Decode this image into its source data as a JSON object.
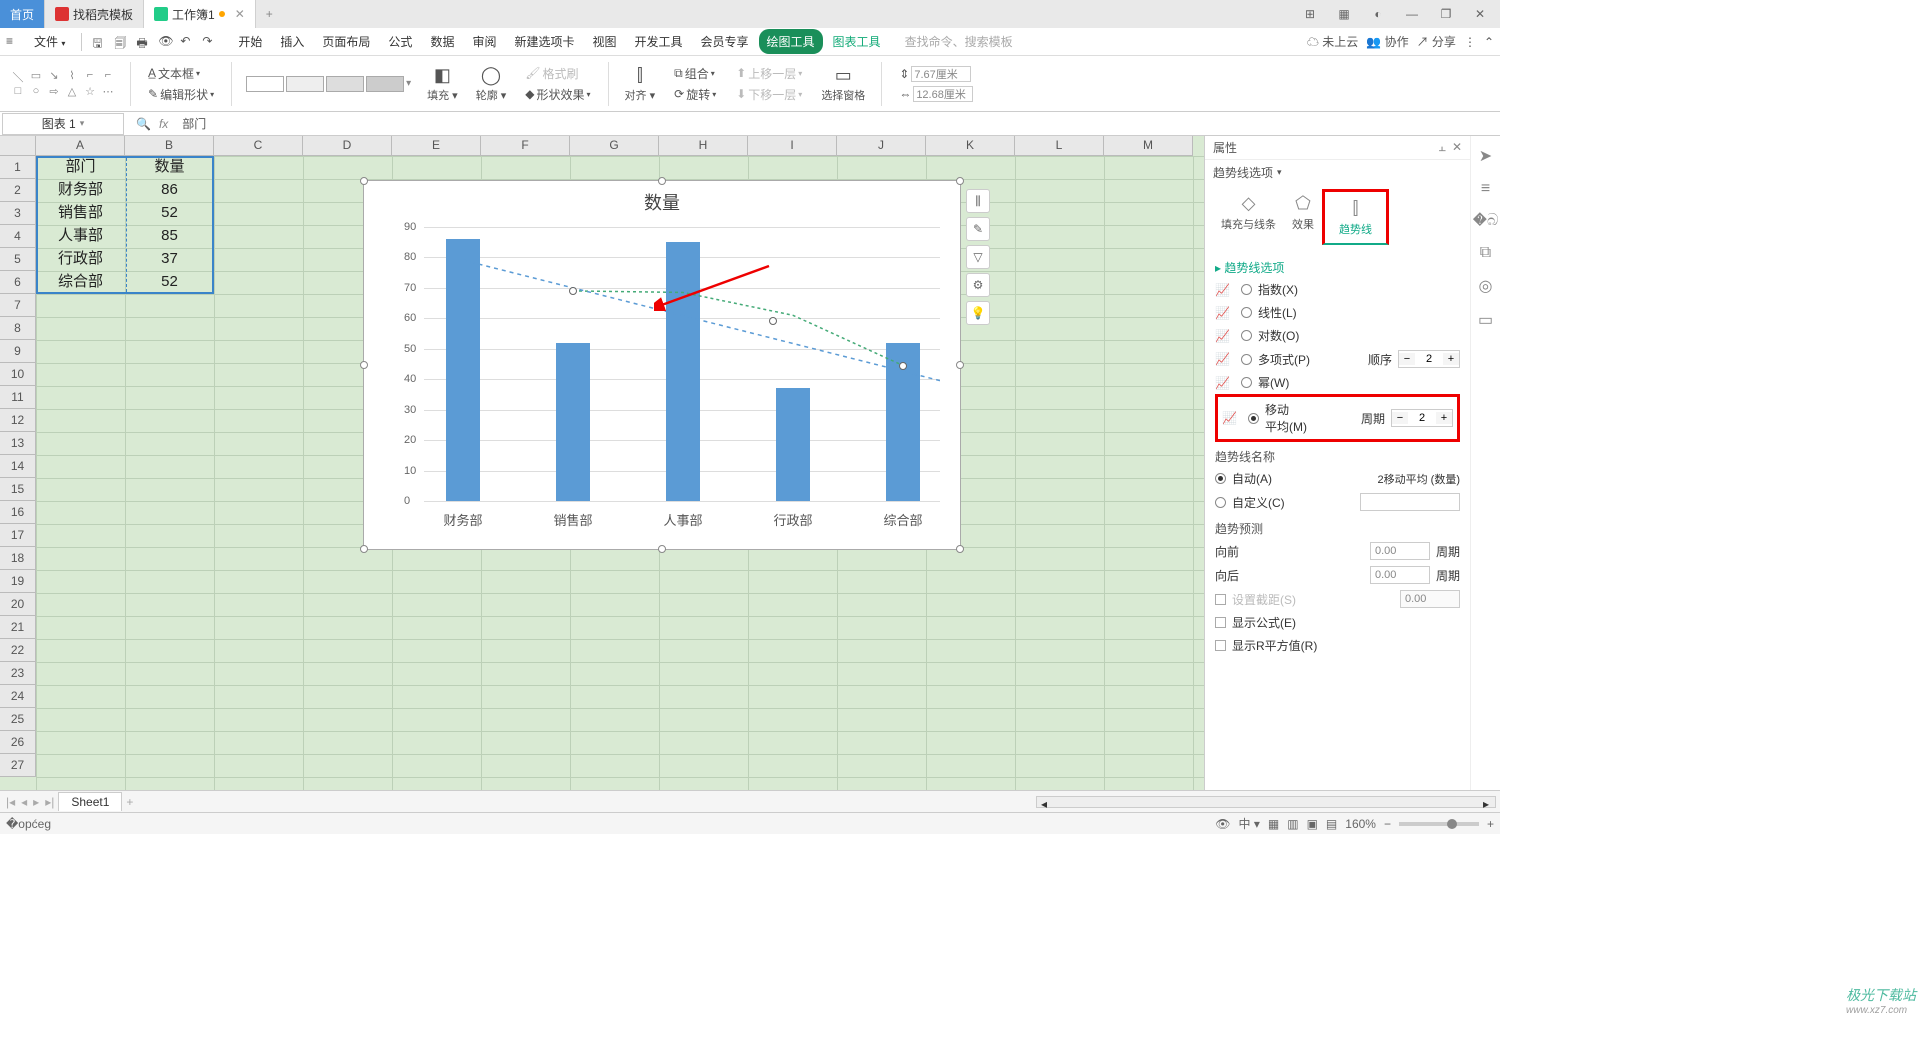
{
  "tabs": {
    "home": "首页",
    "t1": "找稻壳模板",
    "t2": "工作簿1",
    "add": "+"
  },
  "window_controls": {
    "min": "—",
    "max": "□",
    "close": "✕",
    "restore": "❐"
  },
  "menubar": {
    "file": "文件",
    "items": [
      "开始",
      "插入",
      "页面布局",
      "公式",
      "数据",
      "审阅",
      "新建选项卡",
      "视图",
      "开发工具",
      "会员专享",
      "绘图工具",
      "图表工具"
    ],
    "active": "绘图工具",
    "search": "查找命令、搜索模板",
    "right": {
      "cloud": "未上云",
      "coop": "协作",
      "share": "分享"
    }
  },
  "ribbon": {
    "textbox": "文本框",
    "editshape": "编辑形状",
    "fill": "填充",
    "outline": "轮廓",
    "effect": "形状效果",
    "fmt": "格式刷",
    "align": "对齐",
    "group": "组合",
    "rotate": "旋转",
    "up": "上移一层",
    "down": "下移一层",
    "selpane": "选择窗格",
    "h": "7.67厘米",
    "w": "12.68厘米"
  },
  "namebox": "图表 1",
  "fx_value": "部门",
  "columns": [
    "A",
    "B",
    "C",
    "D",
    "E",
    "F",
    "G",
    "H",
    "I",
    "J",
    "K",
    "L",
    "M"
  ],
  "rows": [
    1,
    2,
    3,
    4,
    5,
    6,
    7,
    8,
    9,
    10,
    11,
    12,
    13,
    14,
    15,
    16,
    17,
    18,
    19,
    20,
    21,
    22,
    23,
    24,
    25,
    26,
    27
  ],
  "cells": {
    "A1": "部门",
    "B1": "数量",
    "A2": "财务部",
    "B2": "86",
    "A3": "销售部",
    "B3": "52",
    "A4": "人事部",
    "B4": "85",
    "A5": "行政部",
    "B5": "37",
    "A6": "综合部",
    "B6": "52"
  },
  "chart_title": "数量",
  "chart_data": {
    "type": "bar",
    "title": "数量",
    "categories": [
      "财务部",
      "销售部",
      "人事部",
      "行政部",
      "综合部"
    ],
    "values": [
      86,
      52,
      85,
      37,
      52
    ],
    "ylim": [
      0,
      90
    ],
    "yticks": [
      0,
      10,
      20,
      30,
      40,
      50,
      60,
      70,
      80,
      90
    ],
    "trendlines": [
      {
        "type": "moving_average",
        "period": 2,
        "points": [
          69,
          68.5,
          61,
          44.5
        ]
      },
      {
        "type": "linear"
      }
    ],
    "xlabel": "",
    "ylabel": ""
  },
  "chart_side_btns": [
    "⫼",
    "✎",
    "▽",
    "⚙",
    "💡"
  ],
  "prop": {
    "title": "属性",
    "subtitle": "趋势线选项",
    "tabs": {
      "fill": "填充与线条",
      "effect": "效果",
      "trend": "趋势线"
    },
    "trend_opts_header": "趋势线选项",
    "opts": {
      "exp": "指数(X)",
      "lin": "线性(L)",
      "log": "对数(O)",
      "poly": "多项式(P)",
      "pow": "幂(W)",
      "ma1": "移动",
      "ma2": "平均(M)"
    },
    "order_lbl": "顺序",
    "order_val": "2",
    "period_lbl": "周期",
    "period_val": "2",
    "name_section": "趋势线名称",
    "auto": "自动(A)",
    "custom": "自定义(C)",
    "auto_name": "2移动平均 (数量)",
    "forecast": "趋势预测",
    "fwd": "向前",
    "bwd": "向后",
    "fwd_val": "0.00",
    "bwd_val": "0.00",
    "unit": "周期",
    "intercept": "设置截距(S)",
    "intercept_val": "0.00",
    "showeq": "显示公式(E)",
    "showr2": "显示R平方值(R)"
  },
  "sheet_tabs": {
    "s1": "Sheet1",
    "add": "+"
  },
  "status": {
    "zoom": "160%",
    "view_btns": [
      "▦",
      "▥",
      "▣",
      "▤"
    ]
  },
  "watermark": {
    "brand": "极光下载站",
    "url": "www.xz7.com"
  }
}
